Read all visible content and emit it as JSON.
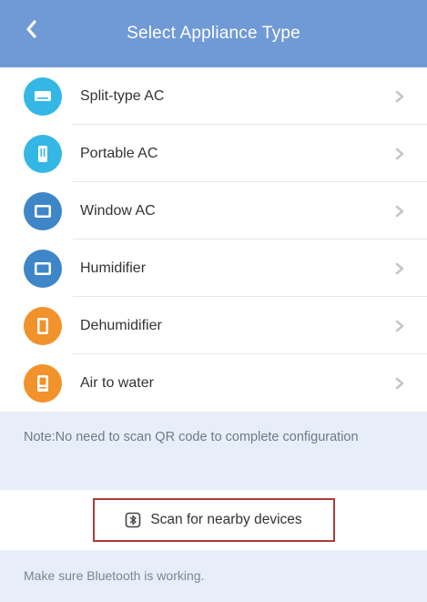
{
  "header": {
    "title": "Select Appliance Type",
    "back_icon": "chevron-left-icon"
  },
  "colors": {
    "header_bg": "#6f9ad6",
    "accent_cyan": "#35b7e6",
    "accent_blue": "#3f86c8",
    "accent_orange": "#f2922b",
    "highlight_border": "#b03a3a"
  },
  "appliances": [
    {
      "label": "Split-type AC",
      "icon": "split-ac-icon"
    },
    {
      "label": "Portable AC",
      "icon": "portable-ac-icon"
    },
    {
      "label": "Window AC",
      "icon": "window-ac-icon"
    },
    {
      "label": "Humidifier",
      "icon": "humidifier-icon"
    },
    {
      "label": "Dehumidifier",
      "icon": "dehumidifier-icon"
    },
    {
      "label": "Air to water",
      "icon": "air-to-water-icon"
    }
  ],
  "note": {
    "text": "Note:No need to scan QR code to complete configuration"
  },
  "scan": {
    "label": "Scan for nearby devices",
    "icon": "bluetooth-scan-icon"
  },
  "footer": {
    "text": "Make sure Bluetooth is working."
  }
}
